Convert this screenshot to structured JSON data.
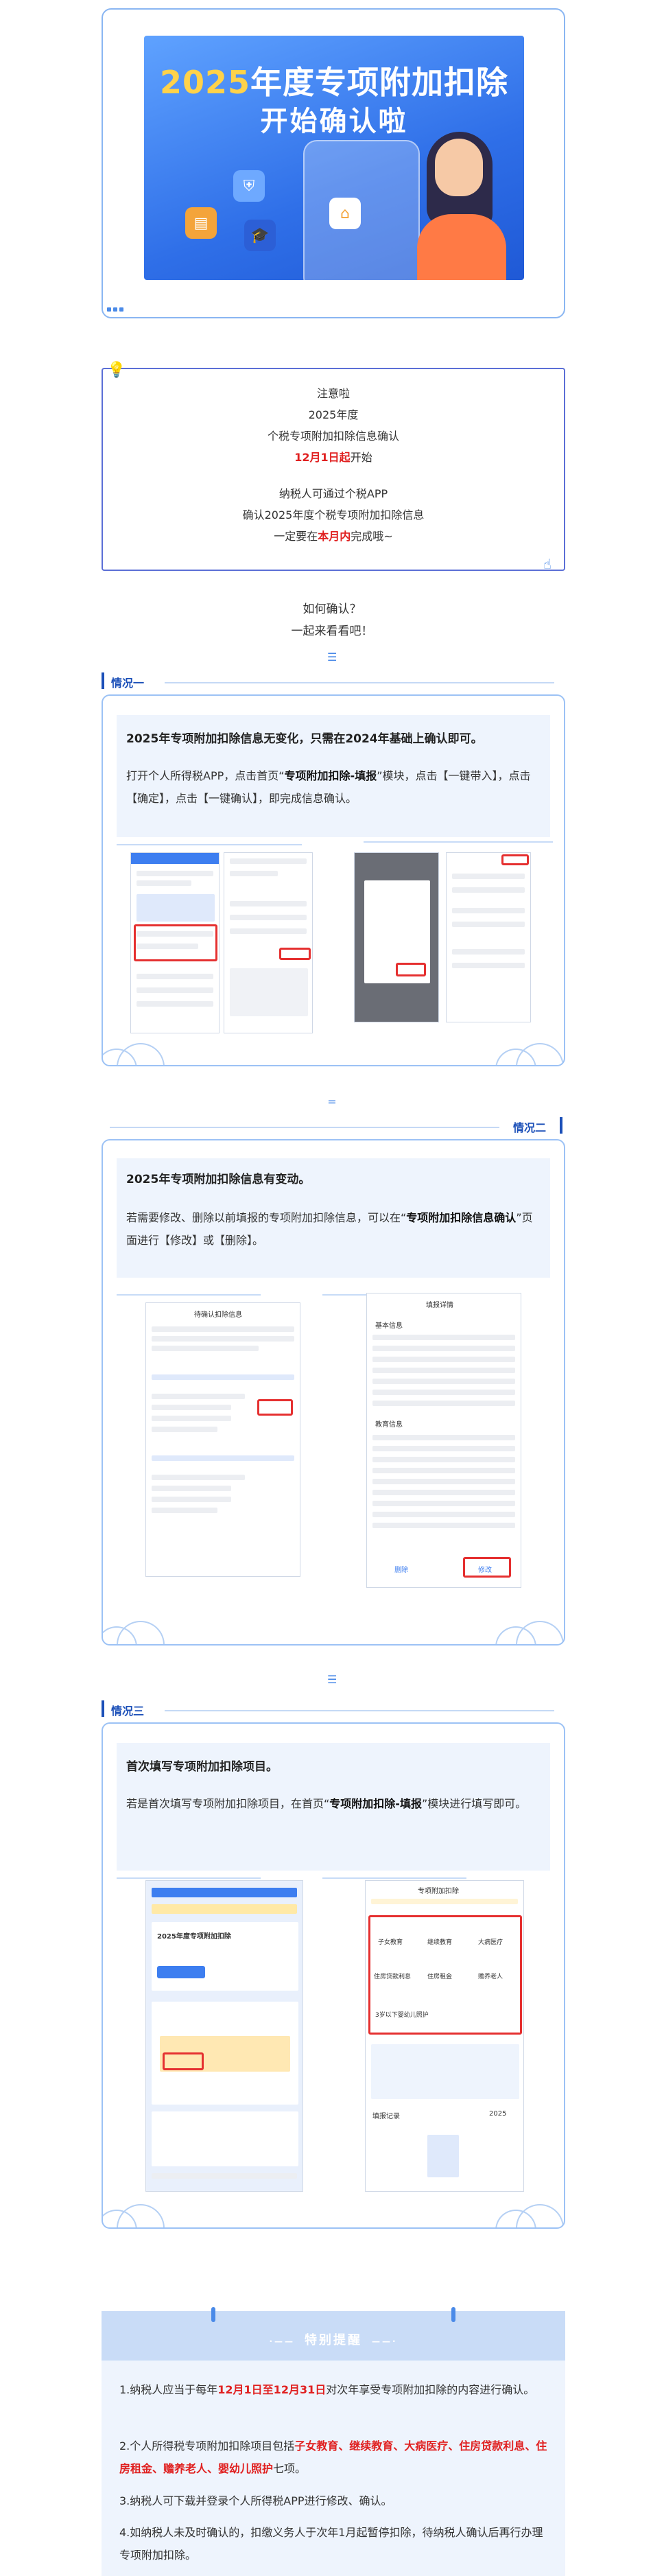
{
  "banner": {
    "year": "2025",
    "title_rest": "年度专项附加扣除",
    "subtitle": "开始确认啦"
  },
  "notice": {
    "line1": "注意啦",
    "line2": "2025年度",
    "line3": "个税专项附加扣除信息确认",
    "line4_red": "12月1日起",
    "line4_rest": "开始",
    "line5": "纳税人可通过个税APP",
    "line6": "确认2025年度个税专项附加扣除信息",
    "line7_pre": "一定要在",
    "line7_red": "本月内",
    "line7_post": "完成哦~"
  },
  "how": {
    "line1": "如何确认？",
    "line2": "一起来看看吧！"
  },
  "case1": {
    "label": "情况一",
    "head": "2025年专项附加扣除信息无变化，只需在2024年基础上确认即可。",
    "text_pre": "打开个人所得税APP，点击首页“",
    "text_bold": "专项附加扣除-填报",
    "text_post": "”模块，点击【一键带入】，点击【确定】，点击【一键确认】，即完成信息确认。"
  },
  "case2": {
    "label": "情况二",
    "head": "2025年专项附加扣除信息有变动。",
    "text_pre": "若需要修改、删除以前填报的专项附加扣除信息，可以在“",
    "text_bold": "专项附加扣除信息确认",
    "text_post": "”页面进行【修改】或【删除】。",
    "shot_left_title": "待确认扣除信息",
    "shot_right_title": "填报详情",
    "shot_right_basic": "基本信息",
    "shot_right_edu": "教育信息",
    "shot_delete": "删除",
    "shot_modify": "修改"
  },
  "case3": {
    "label": "情况三",
    "head": "首次填写专项附加扣除项目。",
    "text_pre": "若是首次填写专项附加扣除项目，在首页“",
    "text_bold": "专项附加扣除-填报",
    "text_post": "”模块进行填写即可。",
    "shot_left_banner": "2025年度专项附加扣除",
    "shot_right_title": "专项附加扣除",
    "shot_right_items": [
      "子女教育",
      "继续教育",
      "大病医疗",
      "住房贷款利息",
      "住房租金",
      "赡养老人",
      "3岁以下婴幼儿照护"
    ],
    "shot_right_records": "填报记录",
    "shot_right_year": "2025"
  },
  "tips": {
    "title": "特别提醒",
    "t1_pre": "1.纳税人应当于每年",
    "t1_red": "12月1日至12月31日",
    "t1_post": "对次年享受专项附加扣除的内容进行确认。",
    "t2_pre": "2.个人所得税专项附加扣除项目包括",
    "t2_red": "子女教育、继续教育、大病医疗、住房贷款利息、住房租金、赡养老人、婴幼儿照护",
    "t2_post": "七项。",
    "t3": "3.纳税人可下载并登录个人所得税APP进行修改、确认。",
    "t4": "4.如纳税人未及时确认的，扣缴义务人于次年1月起暂停扣除，待纳税人确认后再行办理专项附加扣除。"
  }
}
